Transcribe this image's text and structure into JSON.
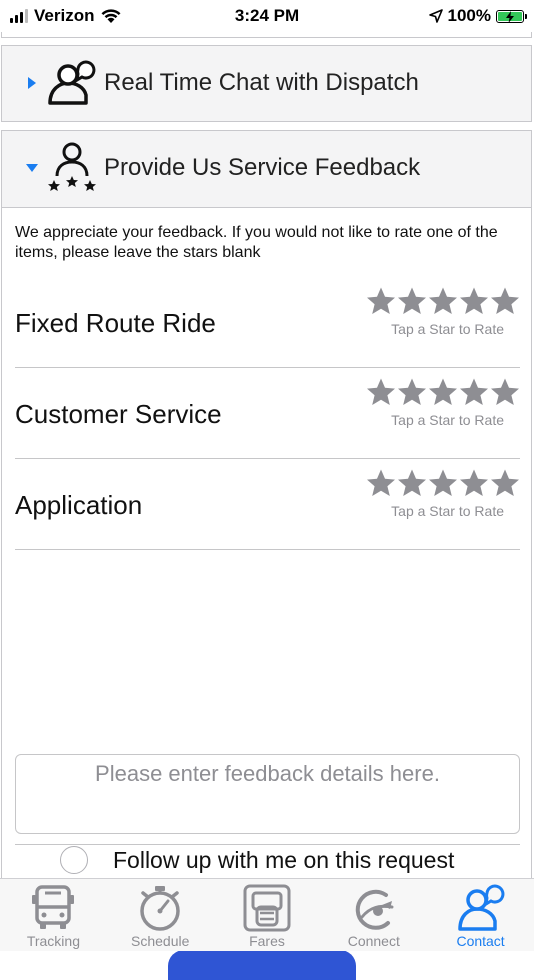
{
  "status_bar": {
    "carrier": "Verizon",
    "time": "3:24 PM",
    "battery": "100%"
  },
  "panels": {
    "chat": {
      "title": "Real Time Chat with Dispatch",
      "expanded": false,
      "icon": "chat-person-icon"
    },
    "feedback": {
      "title": "Provide Us Service Feedback",
      "expanded": true,
      "icon": "person-stars-icon"
    }
  },
  "feedback": {
    "intro": "We appreciate your feedback. If you would not like to rate one of the items, please leave the stars blank",
    "items": [
      {
        "label": "Fixed Route Ride",
        "hint": "Tap a Star to Rate",
        "stars": 5,
        "rating": 0
      },
      {
        "label": "Customer Service",
        "hint": "Tap a Star to Rate",
        "stars": 5,
        "rating": 0
      },
      {
        "label": "Application",
        "hint": "Tap a Star to Rate",
        "stars": 5,
        "rating": 0
      }
    ],
    "details_placeholder": "Please enter feedback details here.",
    "followup_label": "Follow up with me on this request"
  },
  "tabs": [
    {
      "label": "Tracking",
      "icon": "bus-icon",
      "active": false
    },
    {
      "label": "Schedule",
      "icon": "stopwatch-icon",
      "active": false
    },
    {
      "label": "Fares",
      "icon": "fare-card-icon",
      "active": false
    },
    {
      "label": "Connect",
      "icon": "connect-icon",
      "active": false
    },
    {
      "label": "Contact",
      "icon": "contact-person-icon",
      "active": true
    }
  ],
  "colors": {
    "accent": "#1a7df0",
    "star": "#8e8e93",
    "button": "#2f55d4"
  }
}
